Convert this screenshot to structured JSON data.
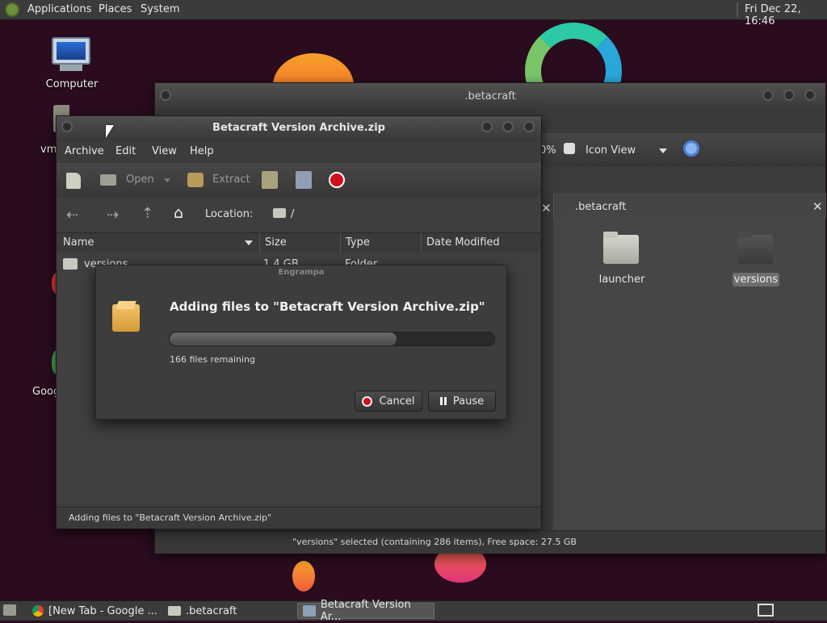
{
  "top_panel": {
    "menus": [
      "Applications",
      "Places",
      "System"
    ],
    "clock": "Fri Dec 22, 16:46"
  },
  "desktop": {
    "icons": [
      "Computer",
      "vm",
      "Goog"
    ]
  },
  "file_manager": {
    "title": ".betacraft",
    "zoom_fragment": "0%",
    "view_mode": "Icon View",
    "tab_label": ".betacraft",
    "items": [
      {
        "label": "launcher",
        "selected": false
      },
      {
        "label": "versions",
        "selected": true
      }
    ],
    "status": "\"versions\" selected (containing 286 items), Free space: 27.5 GB"
  },
  "archive_window": {
    "title": "Betacraft Version Archive.zip",
    "menus": [
      "Archive",
      "Edit",
      "View",
      "Help"
    ],
    "toolbar": {
      "open_label": "Open",
      "extract_label": "Extract"
    },
    "location_label": "Location:",
    "location_value": "/",
    "columns": [
      "Name",
      "Size",
      "Type",
      "Date Modified"
    ],
    "rows": [
      {
        "name": "versions",
        "size": "1.4 GB",
        "type": "Folder",
        "date": ""
      }
    ],
    "status": "Adding files to \"Betacraft Version Archive.zip\""
  },
  "progress_dialog": {
    "app_name": "Engrampa",
    "heading": "Adding files to \"Betacraft Version Archive.zip\"",
    "progress_fraction": 0.7,
    "remaining": "166 files remaining",
    "cancel_label": "Cancel",
    "pause_label": "Pause"
  },
  "taskbar": {
    "tasks": [
      "[New Tab - Google ...",
      ".betacraft",
      "Betacraft Version Ar..."
    ]
  },
  "colors": {
    "desktop_bg": "#2a0c1e",
    "panel_bg": "#3b3b3b",
    "window_bg": "#3c3c3c",
    "stop_red": "#d0101a"
  }
}
